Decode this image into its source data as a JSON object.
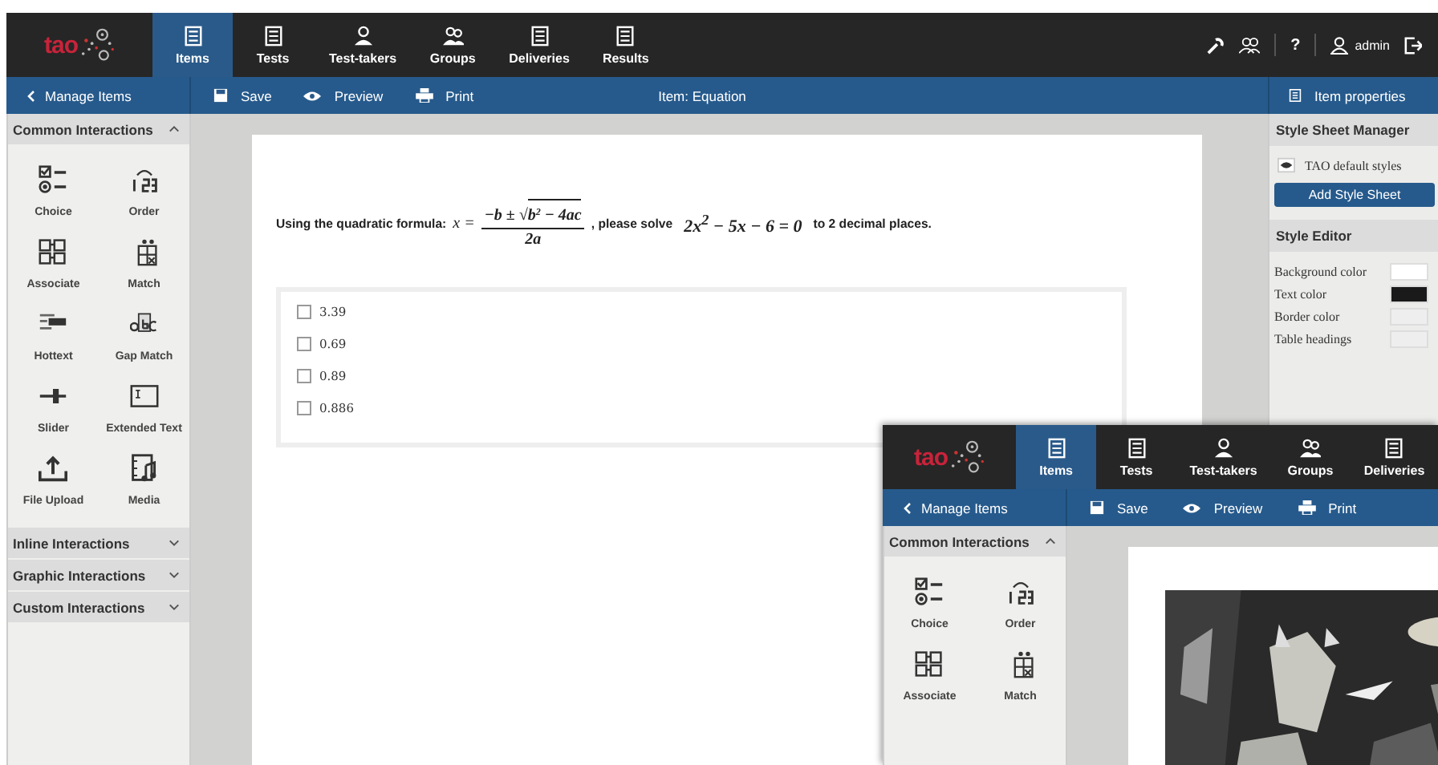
{
  "header": {
    "logo": "tao",
    "tabs": [
      {
        "label": "Items",
        "selected": true
      },
      {
        "label": "Tests",
        "selected": false
      },
      {
        "label": "Test-takers",
        "selected": false
      },
      {
        "label": "Groups",
        "selected": false
      },
      {
        "label": "Deliveries",
        "selected": false
      },
      {
        "label": "Results",
        "selected": false
      }
    ],
    "help": "?",
    "user": "admin"
  },
  "toolbar": {
    "back": "Manage Items",
    "actions": [
      "Save",
      "Preview",
      "Print"
    ],
    "title": "Item: Equation",
    "properties": "Item properties"
  },
  "sidebar": {
    "sections": [
      {
        "title": "Common Interactions",
        "expanded": true,
        "items": [
          "Choice",
          "Order",
          "Associate",
          "Match",
          "Hottext",
          "Gap Match",
          "Slider",
          "Extended Text",
          "File Upload",
          "Media"
        ]
      },
      {
        "title": "Inline Interactions",
        "expanded": false
      },
      {
        "title": "Graphic Interactions",
        "expanded": false
      },
      {
        "title": "Custom Interactions",
        "expanded": false
      }
    ]
  },
  "item": {
    "prompt": {
      "before": "Using the quadratic formula:",
      "lhs": "x =",
      "numerator": "−b ± √",
      "radicand": "b$^{2}$ − 4ac",
      "denominator": "2a",
      "middle": ", please solve",
      "equation": "2x$^{2}$ − 5x − 6 = 0",
      "after": "to 2 decimal places."
    },
    "choices": [
      {
        "label": "3.39",
        "checked": false
      },
      {
        "label": "0.69",
        "checked": false
      },
      {
        "label": "0.89",
        "checked": false
      },
      {
        "label": "0.886",
        "checked": false
      }
    ]
  },
  "properties": {
    "style_sheet_manager": {
      "title": "Style Sheet Manager",
      "stylesheet": "TAO default styles",
      "button": "Add Style Sheet"
    },
    "style_editor": {
      "title": "Style Editor",
      "colors": [
        {
          "label": "Background color",
          "color": "#ffffff"
        },
        {
          "label": "Text color",
          "color": "#1a1a1a"
        },
        {
          "label": "Border color",
          "color": "#eeeeee"
        },
        {
          "label": "Table headings",
          "color": "#eeeeee"
        }
      ]
    }
  },
  "second_screenshot": {
    "logo": "tao",
    "tabs": [
      {
        "label": "Items",
        "selected": true
      },
      {
        "label": "Tests",
        "selected": false
      },
      {
        "label": "Test-takers",
        "selected": false
      },
      {
        "label": "Groups",
        "selected": false
      },
      {
        "label": "Deliveries",
        "selected": false
      }
    ],
    "back": "Manage Items",
    "actions": [
      "Save",
      "Preview",
      "Print"
    ],
    "section": "Common Interactions",
    "items": [
      "Choice",
      "Order",
      "Associate",
      "Match"
    ],
    "kind": "picture"
  }
}
